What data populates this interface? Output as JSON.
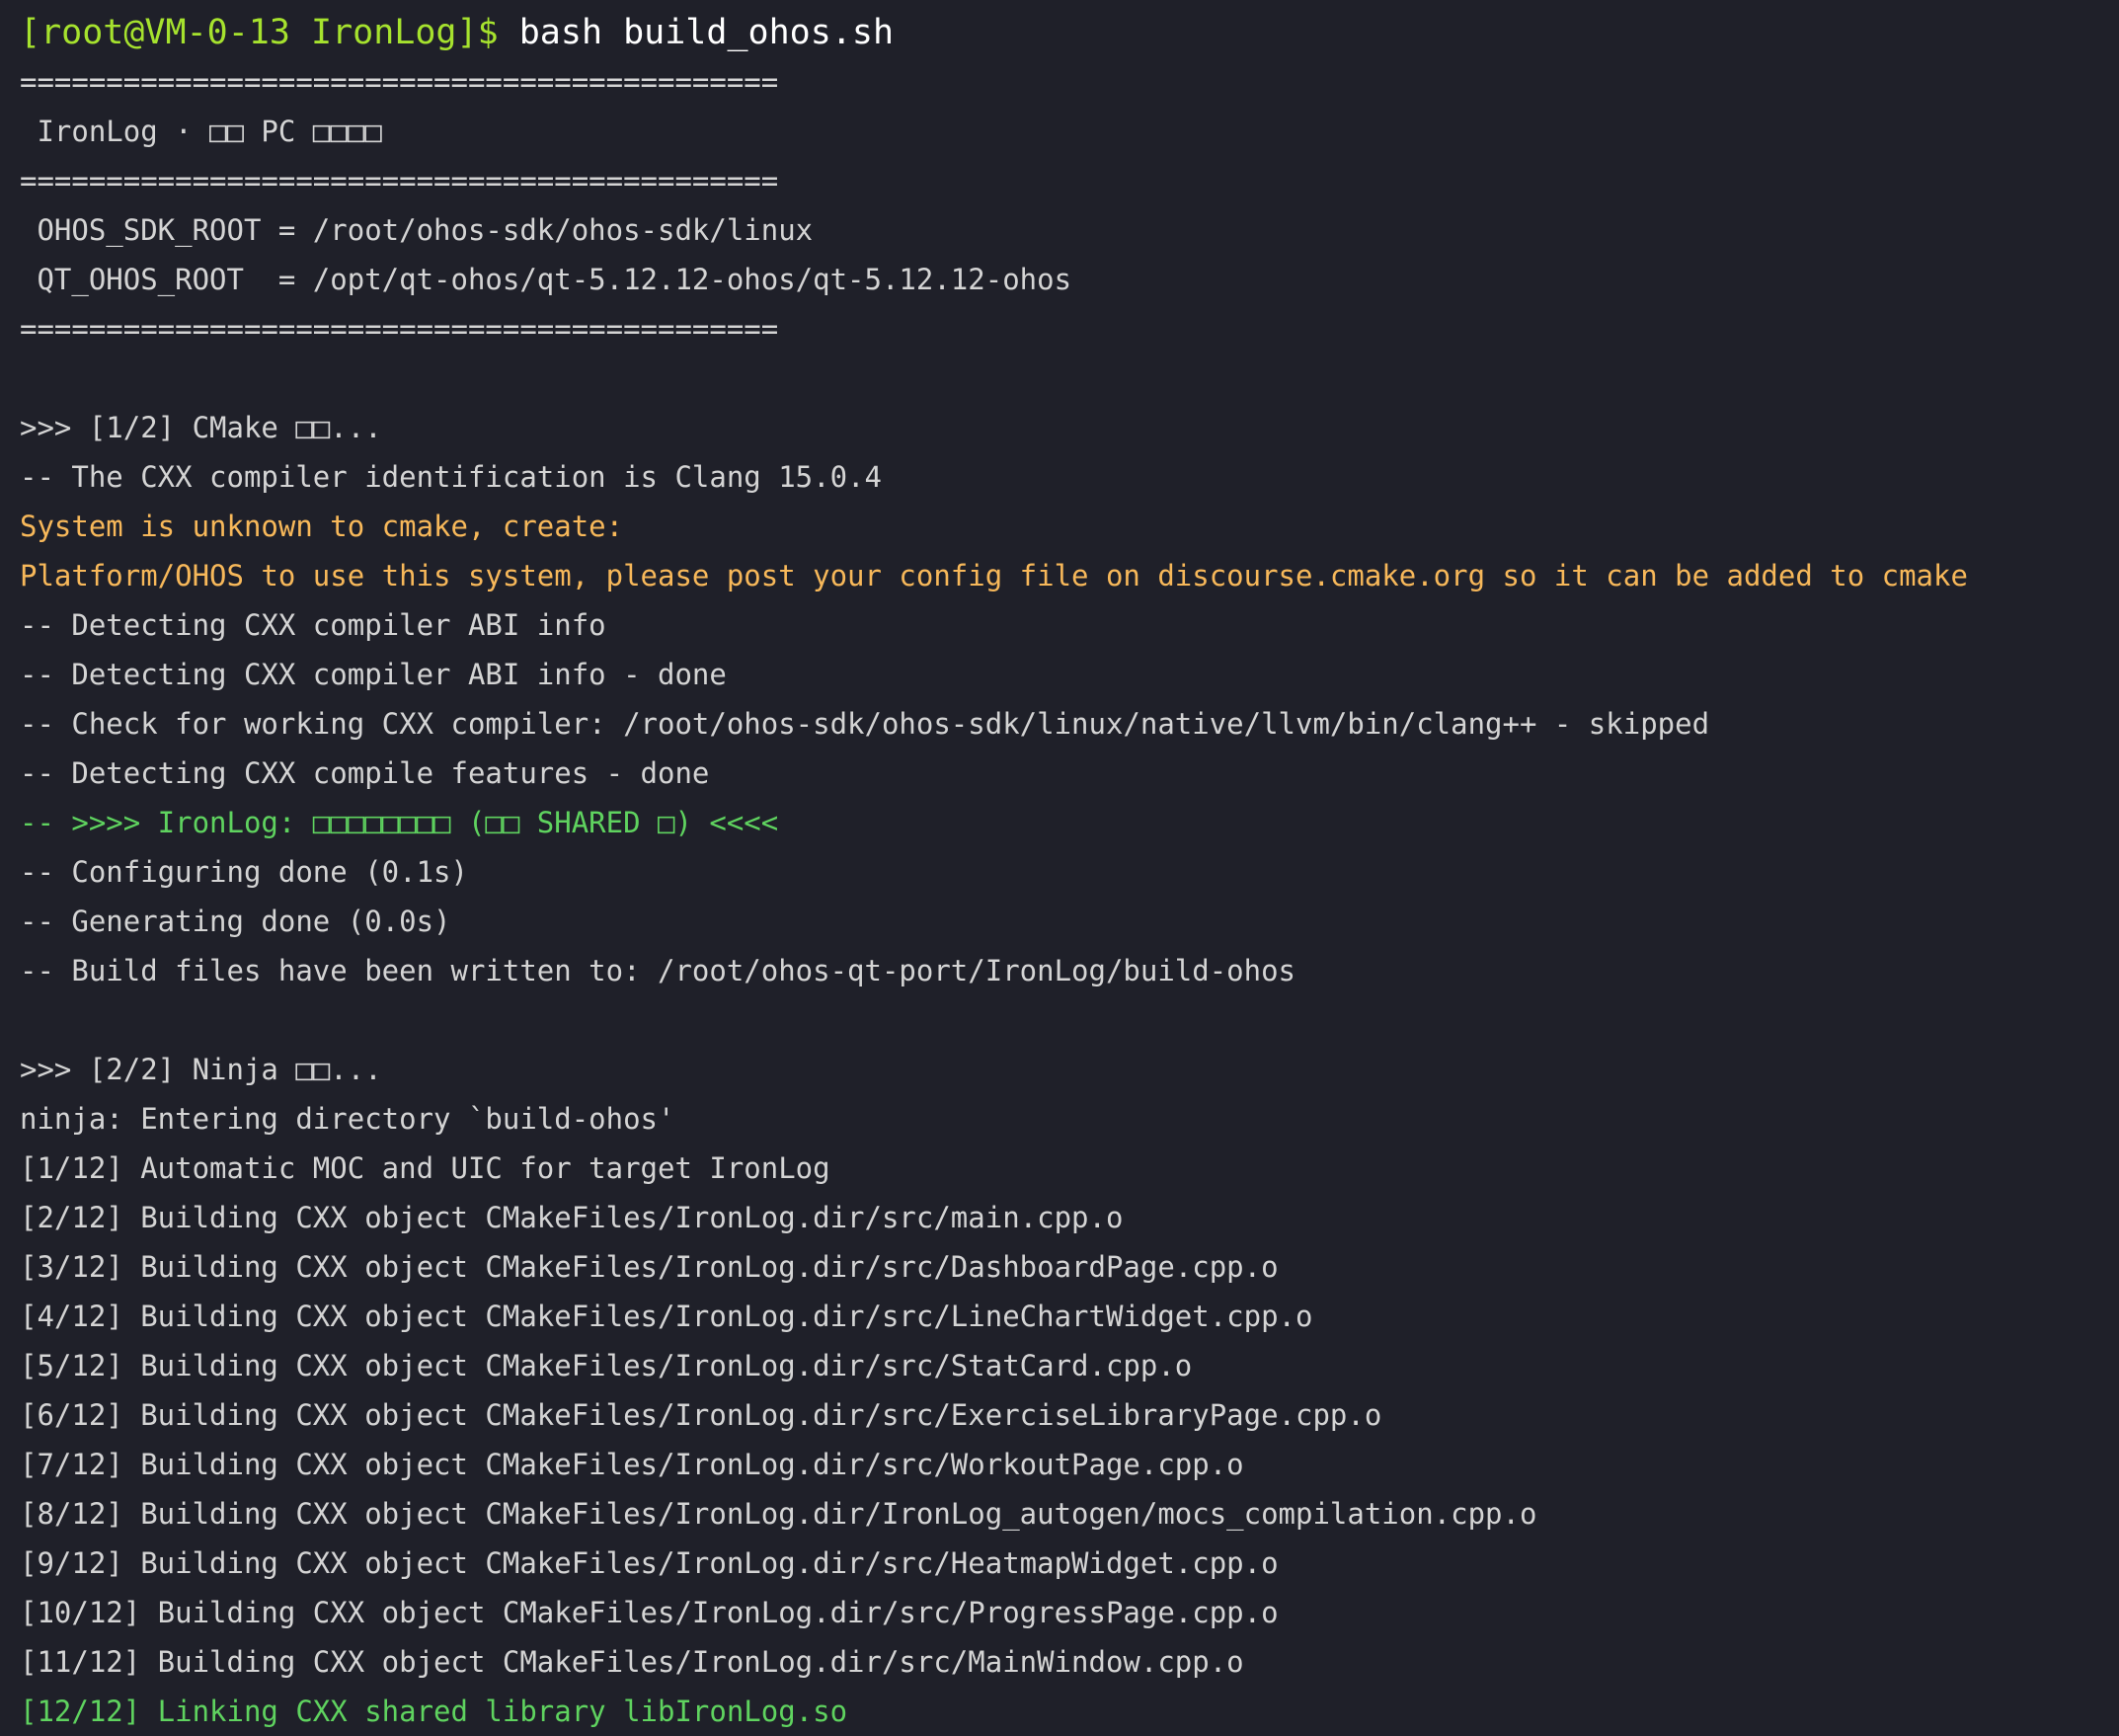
{
  "terminal": {
    "prompt": "[root@VM-0-13 IronLog]$ ",
    "command": "bash build_ohos.sh",
    "colors": {
      "background": "#1f2029",
      "text": "#d4d4d4",
      "prompt": "#a6e22e",
      "warning": "#f7b85a",
      "success": "#5fd35f"
    },
    "lines": [
      {
        "text": "============================================",
        "style": "normal"
      },
      {
        "text": " IronLog · □□ PC □□□□",
        "style": "normal"
      },
      {
        "text": "============================================",
        "style": "normal"
      },
      {
        "text": " OHOS_SDK_ROOT = /root/ohos-sdk/ohos-sdk/linux",
        "style": "normal"
      },
      {
        "text": " QT_OHOS_ROOT  = /opt/qt-ohos/qt-5.12.12-ohos/qt-5.12.12-ohos",
        "style": "normal"
      },
      {
        "text": "============================================",
        "style": "normal"
      },
      {
        "text": "",
        "style": "normal"
      },
      {
        "text": ">>> [1/2] CMake □□...",
        "style": "normal"
      },
      {
        "text": "-- The CXX compiler identification is Clang 15.0.4",
        "style": "normal"
      },
      {
        "text": "System is unknown to cmake, create:",
        "style": "warn"
      },
      {
        "text": "Platform/OHOS to use this system, please post your config file on discourse.cmake.org so it can be added to cmake",
        "style": "warn"
      },
      {
        "text": "-- Detecting CXX compiler ABI info",
        "style": "normal"
      },
      {
        "text": "-- Detecting CXX compiler ABI info - done",
        "style": "normal"
      },
      {
        "text": "-- Check for working CXX compiler: /root/ohos-sdk/ohos-sdk/linux/native/llvm/bin/clang++ - skipped",
        "style": "normal"
      },
      {
        "text": "-- Detecting CXX compile features - done",
        "style": "normal"
      },
      {
        "text": "-- >>>> IronLog: □□□□□□□□ (□□ SHARED □) <<<<",
        "style": "ok"
      },
      {
        "text": "-- Configuring done (0.1s)",
        "style": "normal"
      },
      {
        "text": "-- Generating done (0.0s)",
        "style": "normal"
      },
      {
        "text": "-- Build files have been written to: /root/ohos-qt-port/IronLog/build-ohos",
        "style": "normal"
      },
      {
        "text": "",
        "style": "normal"
      },
      {
        "text": ">>> [2/2] Ninja □□...",
        "style": "normal"
      },
      {
        "text": "ninja: Entering directory `build-ohos'",
        "style": "normal"
      },
      {
        "text": "[1/12] Automatic MOC and UIC for target IronLog",
        "style": "normal"
      },
      {
        "text": "[2/12] Building CXX object CMakeFiles/IronLog.dir/src/main.cpp.o",
        "style": "normal"
      },
      {
        "text": "[3/12] Building CXX object CMakeFiles/IronLog.dir/src/DashboardPage.cpp.o",
        "style": "normal"
      },
      {
        "text": "[4/12] Building CXX object CMakeFiles/IronLog.dir/src/LineChartWidget.cpp.o",
        "style": "normal"
      },
      {
        "text": "[5/12] Building CXX object CMakeFiles/IronLog.dir/src/StatCard.cpp.o",
        "style": "normal"
      },
      {
        "text": "[6/12] Building CXX object CMakeFiles/IronLog.dir/src/ExerciseLibraryPage.cpp.o",
        "style": "normal"
      },
      {
        "text": "[7/12] Building CXX object CMakeFiles/IronLog.dir/src/WorkoutPage.cpp.o",
        "style": "normal"
      },
      {
        "text": "[8/12] Building CXX object CMakeFiles/IronLog.dir/IronLog_autogen/mocs_compilation.cpp.o",
        "style": "normal"
      },
      {
        "text": "[9/12] Building CXX object CMakeFiles/IronLog.dir/src/HeatmapWidget.cpp.o",
        "style": "normal"
      },
      {
        "text": "[10/12] Building CXX object CMakeFiles/IronLog.dir/src/ProgressPage.cpp.o",
        "style": "normal"
      },
      {
        "text": "[11/12] Building CXX object CMakeFiles/IronLog.dir/src/MainWindow.cpp.o",
        "style": "normal"
      },
      {
        "text": "[12/12] Linking CXX shared library libIronLog.so",
        "style": "ok"
      }
    ]
  }
}
